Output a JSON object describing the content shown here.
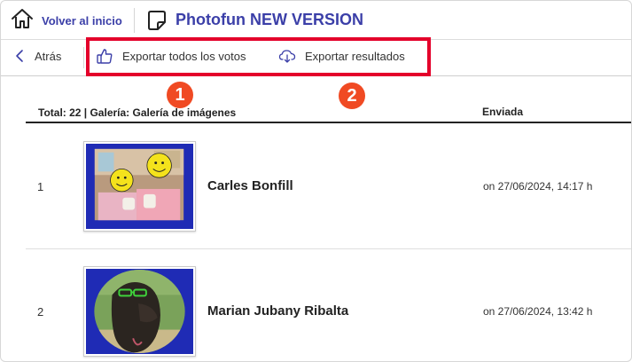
{
  "header": {
    "home_label": "Volver al inicio",
    "home_icon": "home-icon",
    "app_icon": "sticker-icon",
    "app_title": "Photofun NEW VERSION",
    "title_color": "#3b3fa8"
  },
  "toolbar": {
    "back_label": "Atrás",
    "export_votes_label": "Exportar todos los votos",
    "export_votes_icon": "thumbs-up-icon",
    "export_results_label": "Exportar resultados",
    "export_results_icon": "cloud-download-icon"
  },
  "annotations": {
    "highlight_color": "#e4002b",
    "badge_color": "#f04a23",
    "badge_1": "1",
    "badge_2": "2"
  },
  "table": {
    "total_label": "Total: 22 | Galería: Galería de imágenes",
    "sent_header": "Enviada",
    "rows": [
      {
        "num": "1",
        "name": "Carles Bonfill",
        "date": "on 27/06/2024, 14:17 h"
      },
      {
        "num": "2",
        "name": "Marian Jubany Ribalta",
        "date": "on 27/06/2024, 13:42 h"
      }
    ]
  }
}
